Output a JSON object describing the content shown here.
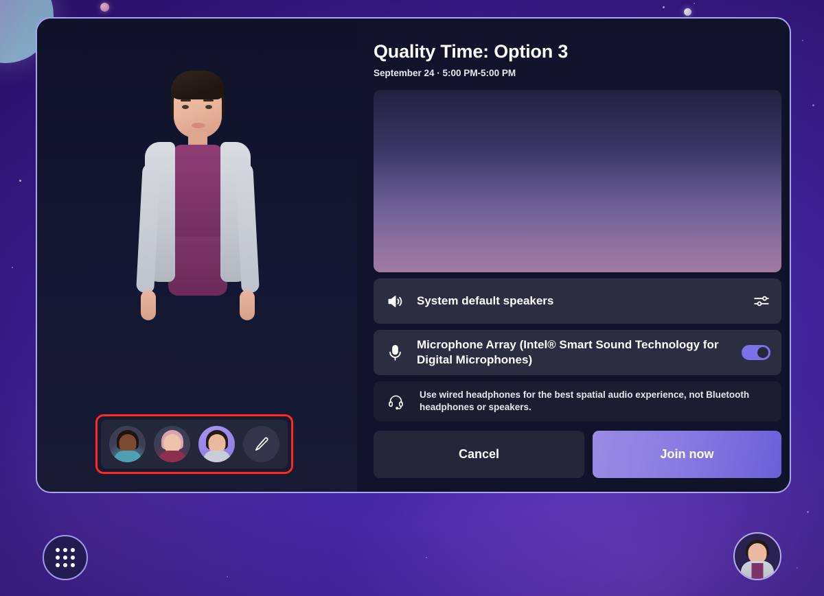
{
  "meeting": {
    "title": "Quality Time: Option 3",
    "subtitle": "September 24 · 5:00 PM-5:00 PM"
  },
  "devices": {
    "speaker": {
      "label": "System default speakers",
      "icon": "speaker-icon",
      "settings_icon": "audio-settings-icon"
    },
    "microphone": {
      "label": "Microphone Array (Intel® Smart Sound Technology for Digital Microphones)",
      "icon": "microphone-icon",
      "toggle_state": "on"
    },
    "tip": {
      "text": "Use wired headphones for the best spatial audio experience, not Bluetooth headphones or speakers.",
      "icon": "headset-icon"
    }
  },
  "actions": {
    "cancel_label": "Cancel",
    "join_label": "Join now"
  },
  "avatar_picker": {
    "items": [
      {
        "name": "avatar-option-1"
      },
      {
        "name": "avatar-option-2"
      },
      {
        "name": "avatar-option-3-selected"
      }
    ],
    "edit_icon": "pencil-icon",
    "highlight_color": "#ff2a1f"
  },
  "taskbar": {
    "app_launcher_icon": "grid-apps-icon",
    "profile_icon": "user-avatar-icon"
  },
  "colors": {
    "accent": "#7b71e8",
    "join_gradient_start": "#9b8ae4",
    "join_gradient_end": "#6a5fd8",
    "dialog_bg": "#11132a",
    "dialog_border": "#a9a6f0",
    "row_bg": "#2b2d40",
    "background": "#3a1f8c"
  }
}
